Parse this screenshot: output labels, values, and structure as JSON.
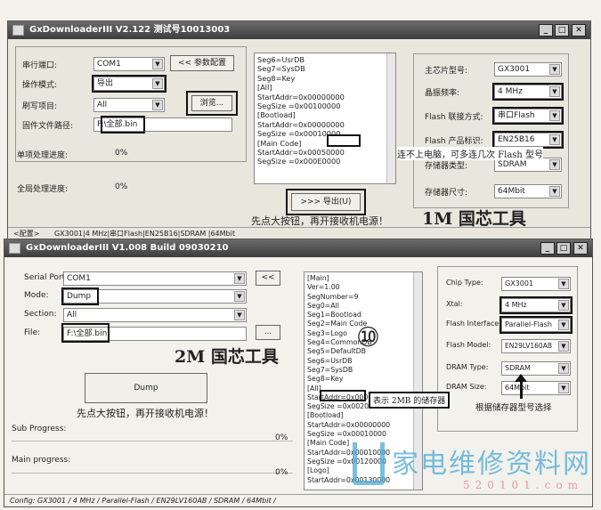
{
  "win1": {
    "title": "GxDownloaderIII V2.122 测试号10013003",
    "port_label": "串行端口:",
    "port_value": "COM1",
    "param_button": "<< 参数配置",
    "mode_label": "操作模式:",
    "mode_value": "导出",
    "burn_label": "刷写项目:",
    "burn_value": "All",
    "browse_button": "浏览...",
    "file_label": "固件文件路径:",
    "file_value": "F:\\全部.bin",
    "single_progress_label": "单项处理进度:",
    "single_progress_value": "0%",
    "total_progress_label": "全局处理进度:",
    "total_progress_value": "0%",
    "export_button": ">>> 导出(U)",
    "list_lines": [
      "Seg6=UsrDB",
      "Seg7=SysDB",
      "Seg8=Key",
      "[All]",
      "StartAddr=0x00000000",
      "SegSize  =0x00100000",
      "[Bootload]",
      "StartAddr=0x00000000",
      "SegSize  =0x00010000",
      "[Main Code]",
      "StartAddr=0x00050000",
      "SegSize  =0x000E0000"
    ],
    "chip_label": "主芯片型号:",
    "chip_value": "GX3001",
    "freq_label": "晶振频率:",
    "freq_value": "4 MHz",
    "flash_conn_label": "Flash 联接方式:",
    "flash_conn_value": "串口Flash",
    "flash_id_label": "Flash 产品标识:",
    "flash_id_value": "EN25B16",
    "mem_type_label": "存储器类型:",
    "mem_type_value": "SDRAM",
    "mem_size_label": "存储器尺寸:",
    "mem_size_value": "64Mbit",
    "status_prefix": "<配置>",
    "status_text": "GX3001|4 MHz|串口Flash|EN25B16|SDRAM |64Mbit"
  },
  "win2": {
    "title": "GxDownloaderIII V1.008 Build 09030210",
    "port_label": "Serial Port:",
    "port_value": "COM1",
    "collapse_button": "<<",
    "mode_label": "Mode:",
    "mode_value": "Dump",
    "section_label": "Section:",
    "section_value": "All",
    "file_label": "File:",
    "file_value": "F:\\全部.bin",
    "browse_button": "...",
    "dump_button": "Dump",
    "sub_progress_label": "Sub Progress:",
    "sub_progress_value": "0%",
    "main_progress_label": "Main progress:",
    "main_progress_value": "0%",
    "list_lines": [
      "[Main]",
      "Ver=1.00",
      "SegNumber=9",
      "Seg0=All",
      "Seg1=Bootload",
      "Seg2=Main Code",
      "Seg3=Logo",
      "Seg4=CommonDB",
      "Seg5=DefaultDB",
      "Seg6=UsrDB",
      "Seg7=SysDB",
      "Seg8=Key",
      "[All]",
      "StartAddr=0x00000000",
      "SegSize  =0x00200000",
      "[Bootload]",
      "StartAddr=0x00000000",
      "SegSize  =0x00010000",
      "[Main Code]",
      "StartAddr=0x00010000",
      "SegSize  =0x00120000",
      "[Logo]",
      "StartAddr=0x00130000"
    ],
    "chip_label": "Chip Type:",
    "chip_value": "GX3001",
    "xtal_label": "Xtal:",
    "xtal_value": "4 MHz",
    "flash_if_label": "Flash Interface:",
    "flash_if_value": "Parallel-Flash",
    "flash_model_label": "Flash Model:",
    "flash_model_value": "EN29LV160AB",
    "dram_type_label": "DRAM Type:",
    "dram_type_value": "SDRAM",
    "dram_size_label": "DRAM Size:",
    "dram_size_value": "64Mbit",
    "status_text": "Config:  GX3001 / 4 MHz / Parallel-Flash / EN29LV160AB / SDRAM / 64Mbit /"
  },
  "notes": {
    "connect_hint": "连不上电脑，可多连几次 Flash 型号",
    "press_first_1": "先点大按钮，再开接收机电源！",
    "tool_1m": "1M 国芯工具",
    "tool_2m": "2M 国芯工具",
    "circle_num": "⑩",
    "press_first_2": "先点大按钮，再开接收机电源！",
    "mem_2mb": "表示 2MB 的储存器",
    "select_by_mem": "根据储存器型号选择",
    "watermark_cn": "家电维修资料网",
    "watermark_num": "520101.com"
  }
}
